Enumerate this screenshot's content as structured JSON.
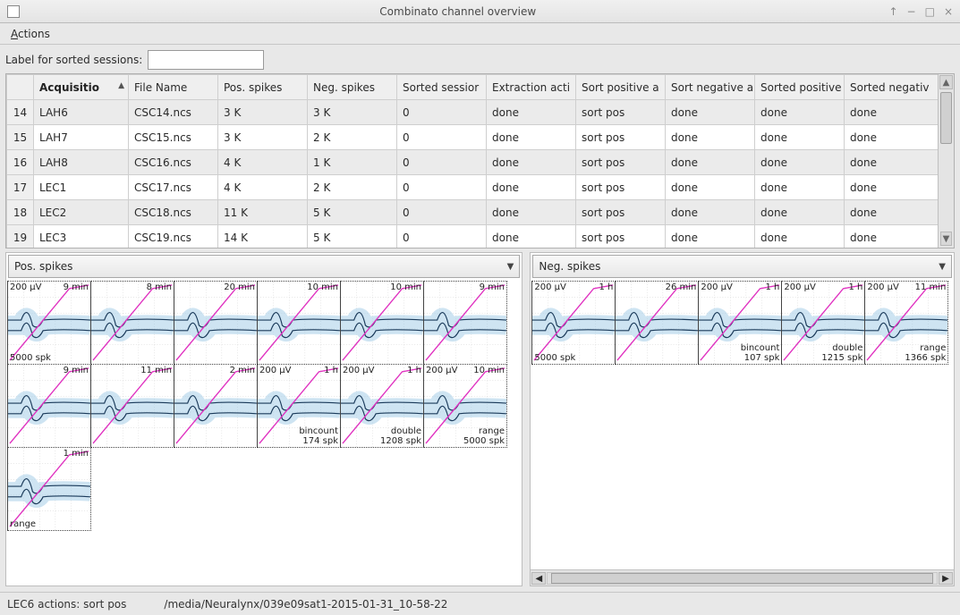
{
  "window": {
    "title": "Combinato channel overview"
  },
  "menu": {
    "actions_label": "Actions"
  },
  "labelrow": {
    "label": "Label for sorted sessions:",
    "value": ""
  },
  "table": {
    "columns": {
      "rownum": "",
      "acq": "Acquisitio",
      "file": "File Name",
      "pos": "Pos. spikes",
      "neg": "Neg. spikes",
      "sess": "Sorted sessior",
      "ext": "Extraction acti",
      "sortpos": "Sort positive a",
      "sortneg": "Sort negative a",
      "sortedpos": "Sorted positive",
      "sortedneg": "Sorted negativ"
    },
    "rows": [
      {
        "n": "14",
        "acq": "LAH6",
        "file": "CSC14.ncs",
        "pos": "3 K",
        "neg": "3 K",
        "sess": "0",
        "ext": "done",
        "sortpos": "sort pos",
        "sortneg": "done",
        "sortedpos": "done",
        "sortedneg": "done"
      },
      {
        "n": "15",
        "acq": "LAH7",
        "file": "CSC15.ncs",
        "pos": "3 K",
        "neg": "2 K",
        "sess": "0",
        "ext": "done",
        "sortpos": "sort pos",
        "sortneg": "done",
        "sortedpos": "done",
        "sortedneg": "done"
      },
      {
        "n": "16",
        "acq": "LAH8",
        "file": "CSC16.ncs",
        "pos": "4 K",
        "neg": "1 K",
        "sess": "0",
        "ext": "done",
        "sortpos": "sort pos",
        "sortneg": "done",
        "sortedpos": "done",
        "sortedneg": "done"
      },
      {
        "n": "17",
        "acq": "LEC1",
        "file": "CSC17.ncs",
        "pos": "4 K",
        "neg": "2 K",
        "sess": "0",
        "ext": "done",
        "sortpos": "sort pos",
        "sortneg": "done",
        "sortedpos": "done",
        "sortedneg": "done"
      },
      {
        "n": "18",
        "acq": "LEC2",
        "file": "CSC18.ncs",
        "pos": "11 K",
        "neg": "5 K",
        "sess": "0",
        "ext": "done",
        "sortpos": "sort pos",
        "sortneg": "done",
        "sortedpos": "done",
        "sortedneg": "done"
      },
      {
        "n": "19",
        "acq": "LEC3",
        "file": "CSC19.ncs",
        "pos": "14 K",
        "neg": "5 K",
        "sess": "0",
        "ext": "done",
        "sortpos": "sort pos",
        "sortneg": "done",
        "sortedpos": "done",
        "sortedneg": "done"
      }
    ]
  },
  "panels": {
    "pos": {
      "selector": "Pos. spikes",
      "thumbs": [
        {
          "tl": "200 µV",
          "tr": "9 min",
          "bl": "5000 spk",
          "br": ""
        },
        {
          "tl": "",
          "tr": "8 min",
          "bl": "",
          "br": ""
        },
        {
          "tl": "",
          "tr": "20 min",
          "bl": "",
          "br": ""
        },
        {
          "tl": "",
          "tr": "10 min",
          "bl": "",
          "br": ""
        },
        {
          "tl": "",
          "tr": "10 min",
          "bl": "",
          "br": ""
        },
        {
          "tl": "",
          "tr": "9 min",
          "bl": "",
          "br": ""
        },
        {
          "tl": "",
          "tr": "9 min",
          "bl": "",
          "br": ""
        },
        {
          "tl": "",
          "tr": "11 min",
          "bl": "",
          "br": ""
        },
        {
          "tl": "",
          "tr": "2 min",
          "bl": "",
          "br": ""
        },
        {
          "tl": "200 µV",
          "tr": "1 h",
          "bl": "",
          "br": "174 spk",
          "br2": "bincount"
        },
        {
          "tl": "200 µV",
          "tr": "1 h",
          "bl": "",
          "br": "1208 spk",
          "br2": "double"
        },
        {
          "tl": "200 µV",
          "tr": "10 min",
          "bl": "",
          "br": "5000 spk",
          "br2": "range"
        },
        {
          "tl": "",
          "tr": "1 min",
          "bl": "range",
          "br": ""
        }
      ]
    },
    "neg": {
      "selector": "Neg. spikes",
      "thumbs": [
        {
          "tl": "200 µV",
          "tr": "1 h",
          "bl": "5000 spk",
          "br": ""
        },
        {
          "tl": "",
          "tr": "26 min",
          "bl": "",
          "br": ""
        },
        {
          "tl": "200 µV",
          "tr": "1 h",
          "bl": "",
          "br": "107 spk",
          "br2": "bincount"
        },
        {
          "tl": "200 µV",
          "tr": "1 h",
          "bl": "",
          "br": "1215 spk",
          "br2": "double"
        },
        {
          "tl": "200 µV",
          "tr": "11 min",
          "bl": "",
          "br": "1366 spk",
          "br2": "range"
        }
      ]
    }
  },
  "status": {
    "left": "LEC6 actions:  sort pos",
    "right": "/media/Neuralynx/039e09sat1-2015-01-31_10-58-22"
  },
  "chart_data": {
    "type": "other",
    "note": "Thumbnails show spike waveform overlays: light-blue density cloud, two dark envelope lines, and a magenta diagonal cumulative curve. Per-thumb annotations captured in panels.pos.thumbs / panels.neg.thumbs."
  }
}
